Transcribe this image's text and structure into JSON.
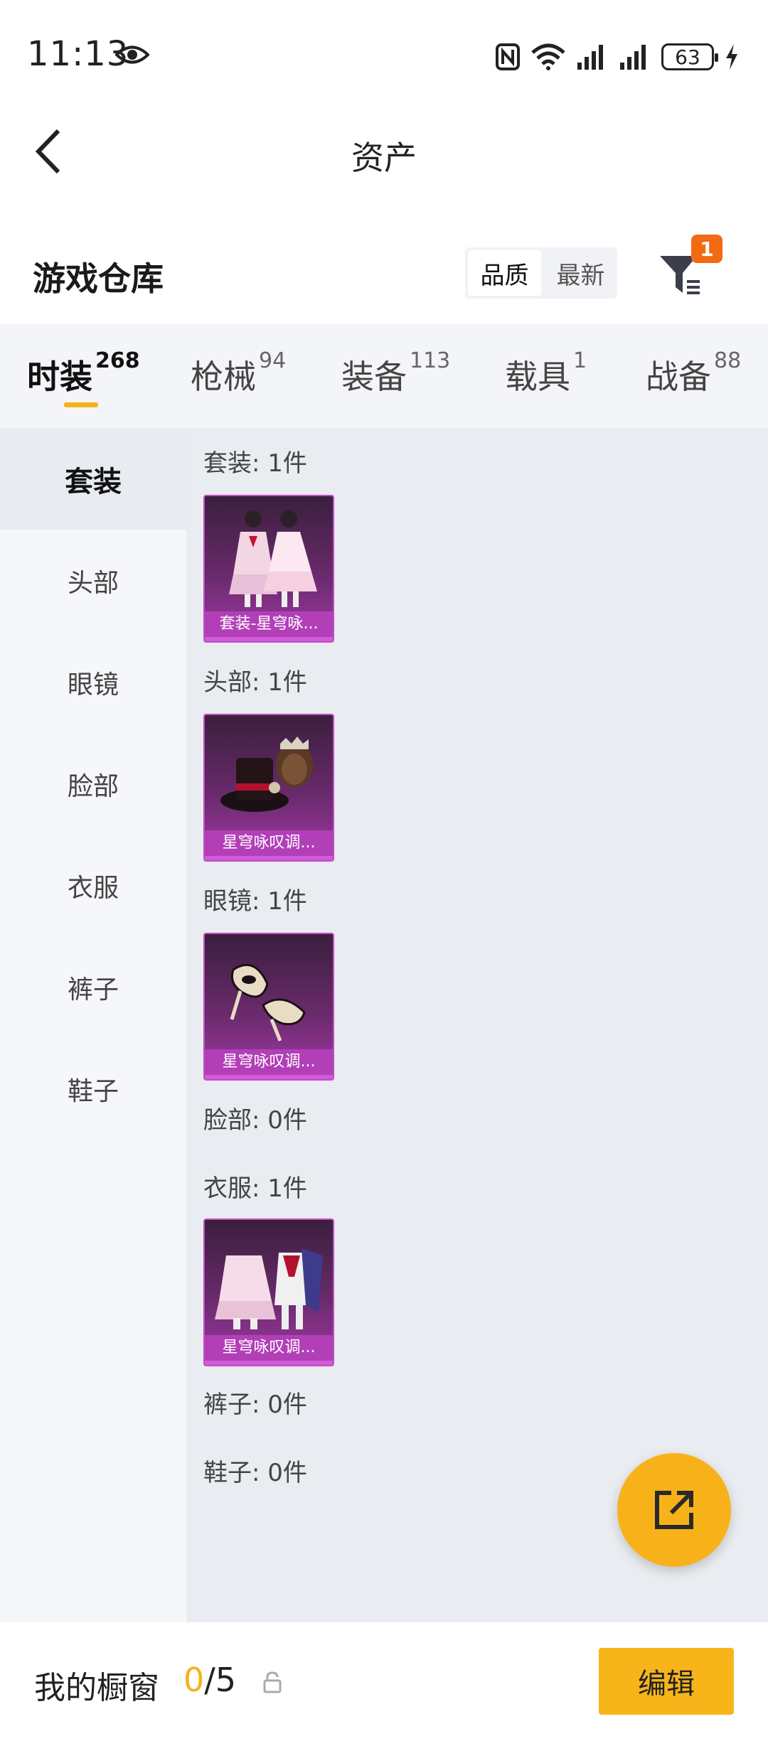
{
  "status_bar": {
    "time": "11:13",
    "battery": "63",
    "icons": [
      "eye-icon",
      "nfc-icon",
      "wifi-icon",
      "signal-icon",
      "signal-icon",
      "battery-icon",
      "charging-icon"
    ]
  },
  "header": {
    "title": "资产",
    "back_icon": "chevron-left-icon"
  },
  "warehouse": {
    "title": "游戏仓库",
    "sort_options": [
      "品质",
      "最新"
    ],
    "sort_selected": "品质",
    "filter_badge": "1",
    "filter_icon": "funnel-icon"
  },
  "category_tabs": [
    {
      "label": "时装",
      "count": "268",
      "active": true
    },
    {
      "label": "枪械",
      "count": "94",
      "active": false
    },
    {
      "label": "装备",
      "count": "113",
      "active": false
    },
    {
      "label": "载具",
      "count": "1",
      "active": false
    },
    {
      "label": "战备",
      "count": "88",
      "active": false
    }
  ],
  "sidebar": {
    "items": [
      {
        "label": "套装",
        "active": true
      },
      {
        "label": "头部",
        "active": false
      },
      {
        "label": "眼镜",
        "active": false
      },
      {
        "label": "脸部",
        "active": false
      },
      {
        "label": "衣服",
        "active": false
      },
      {
        "label": "裤子",
        "active": false
      },
      {
        "label": "鞋子",
        "active": false
      }
    ]
  },
  "groups": [
    {
      "label": "套装: 1件",
      "items": [
        {
          "name": "套装-星穹咏...",
          "icon": "outfit-set-icon"
        }
      ]
    },
    {
      "label": "头部: 1件",
      "items": [
        {
          "name": "星穹咏叹调...",
          "icon": "top-hat-icon"
        }
      ]
    },
    {
      "label": "眼镜: 1件",
      "items": [
        {
          "name": "星穹咏叹调...",
          "icon": "mask-icon"
        }
      ]
    },
    {
      "label": "脸部: 0件",
      "items": []
    },
    {
      "label": "衣服: 1件",
      "items": [
        {
          "name": "星穹咏叹调...",
          "icon": "dress-icon"
        }
      ]
    },
    {
      "label": "裤子: 0件",
      "items": []
    },
    {
      "label": "鞋子: 0件",
      "items": []
    }
  ],
  "fab": {
    "icon": "share-icon"
  },
  "showcase": {
    "title": "我的橱窗",
    "current": "0",
    "total": "/5",
    "lock_icon": "lock-icon",
    "edit_label": "编辑"
  },
  "colors": {
    "accent": "#f7b519",
    "badge": "#f26a12",
    "item_purple": "#b23fb8"
  }
}
